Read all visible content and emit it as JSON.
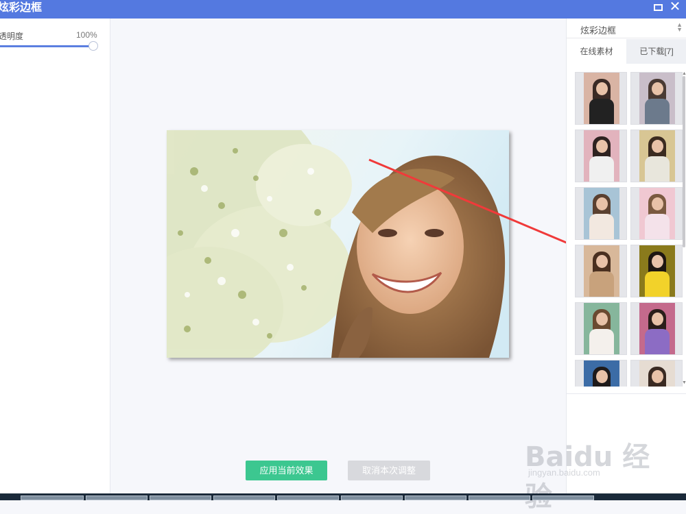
{
  "window": {
    "title": "炫彩边框",
    "maximize_icon": "maximize-icon",
    "close_glyph": "✕"
  },
  "left_panel": {
    "opacity_label": "透明度",
    "opacity_value": "100%",
    "opacity_level": 100
  },
  "actions": {
    "apply_label": "应用当前效果",
    "cancel_label": "取消本次调整"
  },
  "right_panel": {
    "select_value": "炫彩边框",
    "tabs": [
      {
        "label": "在线素材",
        "active": true
      },
      {
        "label": "已下载[7]",
        "active": false
      }
    ],
    "thumbnails": [
      {
        "hair": "#3a2a25",
        "body": "#222222",
        "bg": "#d9b4a4"
      },
      {
        "hair": "#4a3a33",
        "body": "#6c7a8c",
        "bg": "#c9bec9"
      },
      {
        "hair": "#2e2220",
        "body": "#f0f0f0",
        "bg": "#e2b3bd"
      },
      {
        "hair": "#3b2b20",
        "body": "#e8e6dc",
        "bg": "#d8c694"
      },
      {
        "hair": "#5a4030",
        "body": "#f2e8e0",
        "bg": "#a8c4d6"
      },
      {
        "hair": "#7a5a40",
        "body": "#f4e2ea",
        "bg": "#f0c8d2"
      },
      {
        "hair": "#4a3020",
        "body": "#c8a27c",
        "bg": "#d8b89a"
      },
      {
        "hair": "#1e1612",
        "body": "#f2d22a",
        "bg": "#8a7a1c"
      },
      {
        "hair": "#6a4a30",
        "body": "#f4f0ec",
        "bg": "#86b69c"
      },
      {
        "hair": "#2a1e1a",
        "body": "#8c6cc4",
        "bg": "#c46a8c"
      },
      {
        "hair": "#1e1a1a",
        "body": "#6aa4d6",
        "bg": "#3c6ca6"
      },
      {
        "hair": "#3a2a22",
        "body": "#d8c8b8",
        "bg": "#e6dcd2"
      }
    ]
  },
  "watermark": {
    "brand": "Baidu 经验",
    "sub": "jingyan.baidu.com"
  }
}
